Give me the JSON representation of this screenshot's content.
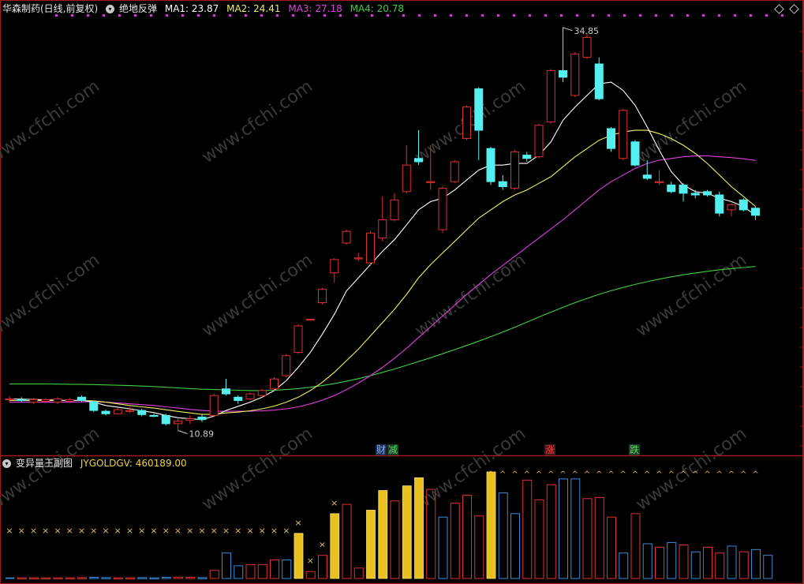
{
  "header": {
    "stock_name": "华森制药(日线,前复权)",
    "indicator_name": "绝地反弹",
    "ma1_label": "MA1: 23.87",
    "ma2_label": "MA2: 24.41",
    "ma3_label": "MA3: 27.18",
    "ma4_label": "MA4: 20.78"
  },
  "sub_header": {
    "indicator_name": "变异量王副图",
    "value_label": "JYGOLDGV: 460189.00"
  },
  "signals": {
    "cai": "财",
    "jian": "减",
    "zhang": "涨",
    "die": "跌"
  },
  "watermark": "www.cfchi.com",
  "colors": {
    "background": "#000000",
    "up": "#e03030",
    "down": "#54f0f0",
    "ma1": "#ffffff",
    "ma2": "#f0f060",
    "ma3": "#e040e0",
    "ma4": "#40d040",
    "gold": "#e8c020",
    "frame": "#a01818"
  },
  "chart_data": {
    "type": "candlestick",
    "price_high_marker": "34.85",
    "price_low_marker": "10.89",
    "y_range": [
      10.2,
      36.0
    ],
    "candles": [
      {
        "o": 12.8,
        "c": 12.8,
        "h": 12.95,
        "l": 12.6
      },
      {
        "o": 12.75,
        "c": 12.7,
        "h": 12.9,
        "l": 12.6
      },
      {
        "o": 12.6,
        "c": 12.75,
        "h": 12.85,
        "l": 12.5
      },
      {
        "o": 12.65,
        "c": 12.75,
        "h": 12.85,
        "l": 12.55
      },
      {
        "o": 12.6,
        "c": 12.8,
        "h": 12.9,
        "l": 12.5
      },
      {
        "o": 12.65,
        "c": 12.75,
        "h": 12.85,
        "l": 12.55
      },
      {
        "o": 12.9,
        "c": 12.7,
        "h": 13.0,
        "l": 12.6
      },
      {
        "o": 12.6,
        "c": 12.1,
        "h": 12.7,
        "l": 12.0
      },
      {
        "o": 12.05,
        "c": 11.9,
        "h": 12.15,
        "l": 11.8
      },
      {
        "o": 11.9,
        "c": 12.15,
        "h": 12.25,
        "l": 11.85
      },
      {
        "o": 12.1,
        "c": 12.1,
        "h": 12.3,
        "l": 11.95
      },
      {
        "o": 12.1,
        "c": 11.85,
        "h": 12.2,
        "l": 11.75
      },
      {
        "o": 11.8,
        "c": 11.75,
        "h": 11.9,
        "l": 11.7
      },
      {
        "o": 11.8,
        "c": 11.3,
        "h": 11.9,
        "l": 11.2
      },
      {
        "o": 11.3,
        "c": 11.45,
        "h": 11.6,
        "l": 10.89
      },
      {
        "o": 11.5,
        "c": 11.6,
        "h": 11.8,
        "l": 11.3
      },
      {
        "o": 11.7,
        "c": 11.55,
        "h": 11.85,
        "l": 11.4
      },
      {
        "o": 11.8,
        "c": 13.0,
        "h": 13.1,
        "l": 11.7
      },
      {
        "o": 13.4,
        "c": 13.1,
        "h": 14.0,
        "l": 13.0
      },
      {
        "o": 12.9,
        "c": 12.7,
        "h": 13.0,
        "l": 12.5
      },
      {
        "o": 12.8,
        "c": 13.1,
        "h": 13.2,
        "l": 12.7
      },
      {
        "o": 13.0,
        "c": 13.3,
        "h": 13.4,
        "l": 12.9
      },
      {
        "o": 13.4,
        "c": 14.0,
        "h": 14.1,
        "l": 13.3
      },
      {
        "o": 14.2,
        "c": 15.4,
        "h": 15.5,
        "l": 14.1
      },
      {
        "o": 15.6,
        "c": 17.2,
        "h": 17.3,
        "l": 15.5
      },
      {
        "o": 17.6,
        "c": 17.6,
        "h": 17.6,
        "l": 17.6
      },
      {
        "o": 18.6,
        "c": 19.4,
        "h": 19.5,
        "l": 18.5
      },
      {
        "o": 20.4,
        "c": 21.2,
        "h": 21.3,
        "l": 19.8
      },
      {
        "o": 22.2,
        "c": 22.9,
        "h": 23.0,
        "l": 22.1
      },
      {
        "o": 21.3,
        "c": 21.3,
        "h": 21.6,
        "l": 21.1
      },
      {
        "o": 21.0,
        "c": 22.8,
        "h": 22.9,
        "l": 20.8
      },
      {
        "o": 22.5,
        "c": 23.6,
        "h": 25.0,
        "l": 22.3
      },
      {
        "o": 23.6,
        "c": 24.8,
        "h": 25.2,
        "l": 23.5
      },
      {
        "o": 25.3,
        "c": 26.9,
        "h": 28.1,
        "l": 25.2
      },
      {
        "o": 27.3,
        "c": 27.1,
        "h": 29.0,
        "l": 26.9
      },
      {
        "o": 25.9,
        "c": 25.9,
        "h": 28.1,
        "l": 25.4
      },
      {
        "o": 23.0,
        "c": 25.5,
        "h": 25.6,
        "l": 22.8
      },
      {
        "o": 25.9,
        "c": 27.1,
        "h": 27.2,
        "l": 25.8
      },
      {
        "o": 28.5,
        "c": 30.4,
        "h": 30.5,
        "l": 28.4
      },
      {
        "o": 31.5,
        "c": 29.0,
        "h": 31.6,
        "l": 27.2
      },
      {
        "o": 27.9,
        "c": 25.9,
        "h": 28.0,
        "l": 25.7
      },
      {
        "o": 25.9,
        "c": 25.6,
        "h": 26.3,
        "l": 25.4
      },
      {
        "o": 25.5,
        "c": 27.7,
        "h": 27.8,
        "l": 25.4
      },
      {
        "o": 27.5,
        "c": 27.3,
        "h": 27.7,
        "l": 27.1
      },
      {
        "o": 27.4,
        "c": 29.3,
        "h": 29.4,
        "l": 27.3
      },
      {
        "o": 29.5,
        "c": 32.6,
        "h": 32.7,
        "l": 29.4
      },
      {
        "o": 32.6,
        "c": 32.2,
        "h": 35.2,
        "l": 31.9
      },
      {
        "o": 31.1,
        "c": 33.6,
        "h": 33.7,
        "l": 31.0
      },
      {
        "o": 33.4,
        "c": 34.6,
        "h": 34.85,
        "l": 33.3
      },
      {
        "o": 33.0,
        "c": 30.9,
        "h": 33.4,
        "l": 30.8
      },
      {
        "o": 29.1,
        "c": 27.9,
        "h": 29.2,
        "l": 27.7
      },
      {
        "o": 27.3,
        "c": 30.2,
        "h": 30.3,
        "l": 27.2
      },
      {
        "o": 28.3,
        "c": 26.9,
        "h": 28.4,
        "l": 26.8
      },
      {
        "o": 26.3,
        "c": 26.1,
        "h": 27.2,
        "l": 26.0
      },
      {
        "o": 25.9,
        "c": 25.9,
        "h": 26.6,
        "l": 25.7
      },
      {
        "o": 25.7,
        "c": 25.3,
        "h": 25.9,
        "l": 25.2
      },
      {
        "o": 25.7,
        "c": 25.2,
        "h": 25.8,
        "l": 24.7
      },
      {
        "o": 25.2,
        "c": 25.1,
        "h": 25.4,
        "l": 24.9
      },
      {
        "o": 25.3,
        "c": 25.1,
        "h": 25.4,
        "l": 25.0
      },
      {
        "o": 25.1,
        "c": 24.0,
        "h": 25.3,
        "l": 23.8
      },
      {
        "o": 24.2,
        "c": 24.5,
        "h": 24.6,
        "l": 23.8
      },
      {
        "o": 24.8,
        "c": 24.2,
        "h": 24.9,
        "l": 24.1
      },
      {
        "o": 24.3,
        "c": 23.87,
        "h": 24.4,
        "l": 23.6
      }
    ],
    "ma1": [
      12.8,
      12.78,
      12.76,
      12.74,
      12.72,
      12.7,
      12.72,
      12.6,
      12.4,
      12.3,
      12.2,
      12.08,
      11.97,
      11.8,
      11.66,
      11.6,
      11.54,
      11.76,
      12.1,
      12.35,
      12.6,
      12.9,
      13.3,
      13.9,
      14.7,
      15.6,
      16.7,
      17.9,
      19.3,
      20.1,
      20.9,
      21.7,
      22.4,
      23.3,
      24.2,
      24.7,
      24.9,
      25.4,
      26.0,
      26.6,
      26.9,
      26.9,
      27.0,
      27.0,
      27.5,
      28.3,
      29.6,
      30.4,
      31.1,
      31.8,
      31.9,
      31.4,
      30.5,
      29.2,
      27.8,
      26.5,
      25.7,
      25.3,
      25.2,
      24.9,
      24.7,
      24.4,
      23.87
    ],
    "ma2": [
      12.7,
      12.7,
      12.7,
      12.7,
      12.7,
      12.7,
      12.7,
      12.68,
      12.6,
      12.5,
      12.4,
      12.32,
      12.24,
      12.14,
      12.04,
      11.95,
      11.86,
      11.86,
      11.95,
      12.0,
      12.08,
      12.2,
      12.36,
      12.6,
      12.9,
      13.3,
      13.8,
      14.4,
      15.1,
      15.8,
      16.6,
      17.4,
      18.2,
      19.1,
      20.1,
      20.9,
      21.6,
      22.3,
      23.0,
      23.7,
      24.2,
      24.7,
      25.1,
      25.4,
      25.8,
      26.2,
      26.8,
      27.4,
      27.9,
      28.4,
      28.7,
      28.9,
      29.0,
      29.0,
      28.8,
      28.5,
      28.1,
      27.6,
      27.0,
      26.3,
      25.6,
      25.0,
      24.41
    ],
    "ma3": [
      12.6,
      12.6,
      12.6,
      12.6,
      12.6,
      12.6,
      12.62,
      12.62,
      12.6,
      12.55,
      12.5,
      12.45,
      12.4,
      12.32,
      12.24,
      12.16,
      12.1,
      12.06,
      12.05,
      12.05,
      12.05,
      12.08,
      12.12,
      12.2,
      12.32,
      12.5,
      12.72,
      13.0,
      13.35,
      13.75,
      14.2,
      14.7,
      15.25,
      15.85,
      16.5,
      17.15,
      17.8,
      18.45,
      19.1,
      19.7,
      20.3,
      20.85,
      21.4,
      21.95,
      22.5,
      23.05,
      23.6,
      24.2,
      24.8,
      25.4,
      25.9,
      26.3,
      26.7,
      27.0,
      27.2,
      27.3,
      27.4,
      27.45,
      27.45,
      27.4,
      27.35,
      27.28,
      27.18
    ],
    "ma4": [
      13.7,
      13.7,
      13.7,
      13.7,
      13.69,
      13.68,
      13.67,
      13.66,
      13.64,
      13.62,
      13.6,
      13.57,
      13.54,
      13.5,
      13.46,
      13.42,
      13.38,
      13.36,
      13.34,
      13.32,
      13.3,
      13.3,
      13.32,
      13.36,
      13.42,
      13.5,
      13.6,
      13.72,
      13.86,
      14.02,
      14.2,
      14.4,
      14.6,
      14.82,
      15.05,
      15.28,
      15.52,
      15.77,
      16.02,
      16.28,
      16.55,
      16.83,
      17.12,
      17.42,
      17.73,
      18.03,
      18.32,
      18.6,
      18.86,
      19.1,
      19.32,
      19.52,
      19.7,
      19.87,
      20.02,
      20.16,
      20.28,
      20.39,
      20.49,
      20.58,
      20.66,
      20.72,
      20.78
    ]
  },
  "volume_data": {
    "type": "bar",
    "max": 460189,
    "bars": [
      {
        "v": 4000,
        "s": "cyanfill"
      },
      {
        "v": 3000,
        "s": "red"
      },
      {
        "v": 3000,
        "s": "red"
      },
      {
        "v": 3000,
        "s": "red"
      },
      {
        "v": 3000,
        "s": "red"
      },
      {
        "v": 3000,
        "s": "red"
      },
      {
        "v": 4000,
        "s": "red"
      },
      {
        "v": 5000,
        "s": "blue"
      },
      {
        "v": 4000,
        "s": "blue"
      },
      {
        "v": 3000,
        "s": "red"
      },
      {
        "v": 3000,
        "s": "red"
      },
      {
        "v": 4000,
        "s": "blue"
      },
      {
        "v": 3000,
        "s": "blue"
      },
      {
        "v": 5000,
        "s": "blue"
      },
      {
        "v": 6000,
        "s": "red"
      },
      {
        "v": 5000,
        "s": "red"
      },
      {
        "v": 4000,
        "s": "blue"
      },
      {
        "v": 35000,
        "s": "red"
      },
      {
        "v": 110000,
        "s": "blue"
      },
      {
        "v": 55000,
        "s": "blue"
      },
      {
        "v": 60000,
        "s": "red"
      },
      {
        "v": 60000,
        "s": "red"
      },
      {
        "v": 80000,
        "s": "red"
      },
      {
        "v": 80000,
        "s": "blue"
      },
      {
        "v": 195000,
        "s": "gold"
      },
      {
        "v": 30000,
        "s": "red"
      },
      {
        "v": 100000,
        "s": "red"
      },
      {
        "v": 280000,
        "s": "gold"
      },
      {
        "v": 320000,
        "s": "red"
      },
      {
        "v": 45000,
        "s": "red"
      },
      {
        "v": 295000,
        "s": "gold"
      },
      {
        "v": 380000,
        "s": "gold"
      },
      {
        "v": 335000,
        "s": "red"
      },
      {
        "v": 400000,
        "s": "gold"
      },
      {
        "v": 435000,
        "s": "gold"
      },
      {
        "v": 385000,
        "s": "red"
      },
      {
        "v": 265000,
        "s": "blue"
      },
      {
        "v": 325000,
        "s": "red"
      },
      {
        "v": 360000,
        "s": "red"
      },
      {
        "v": 270000,
        "s": "red"
      },
      {
        "v": 460189,
        "s": "gold"
      },
      {
        "v": 370000,
        "s": "blue"
      },
      {
        "v": 280000,
        "s": "blue"
      },
      {
        "v": 425000,
        "s": "red"
      },
      {
        "v": 340000,
        "s": "red"
      },
      {
        "v": 405000,
        "s": "red"
      },
      {
        "v": 430000,
        "s": "blue"
      },
      {
        "v": 430000,
        "s": "blue"
      },
      {
        "v": 345000,
        "s": "red"
      },
      {
        "v": 350000,
        "s": "red"
      },
      {
        "v": 265000,
        "s": "red"
      },
      {
        "v": 110000,
        "s": "blue"
      },
      {
        "v": 280000,
        "s": "red"
      },
      {
        "v": 150000,
        "s": "blue"
      },
      {
        "v": 135000,
        "s": "red"
      },
      {
        "v": 155000,
        "s": "blue"
      },
      {
        "v": 145000,
        "s": "red"
      },
      {
        "v": 115000,
        "s": "blue"
      },
      {
        "v": 135000,
        "s": "red"
      },
      {
        "v": 110000,
        "s": "red"
      },
      {
        "v": 140000,
        "s": "blue"
      },
      {
        "v": 115000,
        "s": "red"
      },
      {
        "v": 125000,
        "s": "blue"
      },
      {
        "v": 100000,
        "s": "blue"
      }
    ],
    "x_markers": "××××××××××××××××××××××××××××",
    "caret_markers": "^^^^^^^^^^^^^^^^^^^^^^^"
  }
}
